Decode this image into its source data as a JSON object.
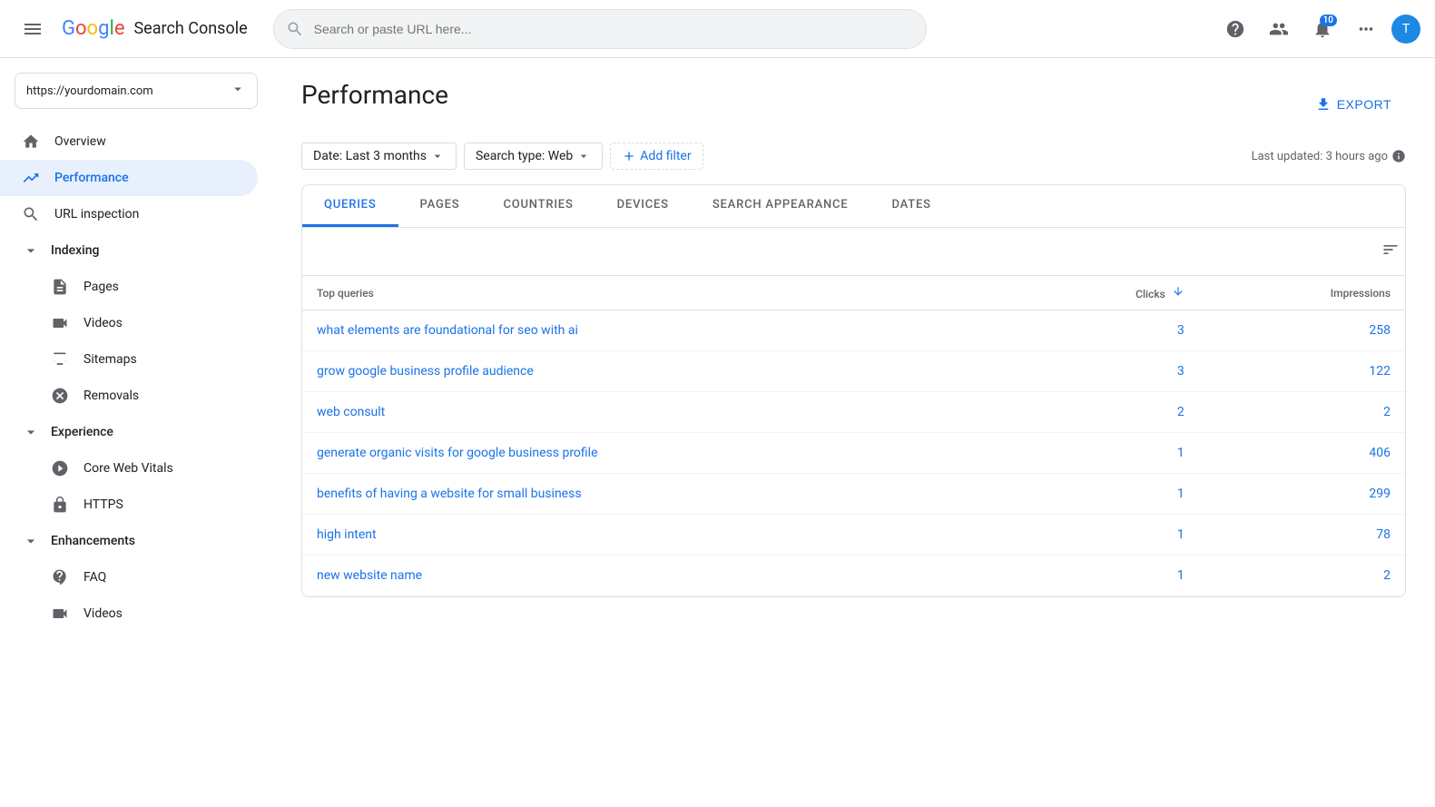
{
  "header": {
    "search_placeholder": "Search or paste URL here...",
    "app_name": "Search Console",
    "notification_count": "10",
    "avatar_letter": "T"
  },
  "sidebar": {
    "property_selector": "https://yourdomain.com",
    "nav_items": [
      {
        "id": "overview",
        "label": "Overview",
        "icon": "home"
      },
      {
        "id": "performance",
        "label": "Performance",
        "icon": "trending-up",
        "active": true
      },
      {
        "id": "url-inspection",
        "label": "URL inspection",
        "icon": "search"
      }
    ],
    "sections": [
      {
        "id": "indexing",
        "label": "Indexing",
        "children": [
          {
            "id": "pages",
            "label": "Pages",
            "icon": "document"
          },
          {
            "id": "videos",
            "label": "Videos",
            "icon": "video"
          },
          {
            "id": "sitemaps",
            "label": "Sitemaps",
            "icon": "sitemap"
          },
          {
            "id": "removals",
            "label": "Removals",
            "icon": "removals"
          }
        ]
      },
      {
        "id": "experience",
        "label": "Experience",
        "children": [
          {
            "id": "core-web-vitals",
            "label": "Core Web Vitals",
            "icon": "cwv"
          },
          {
            "id": "https",
            "label": "HTTPS",
            "icon": "lock"
          }
        ]
      },
      {
        "id": "enhancements",
        "label": "Enhancements",
        "children": [
          {
            "id": "faq",
            "label": "FAQ",
            "icon": "faq"
          },
          {
            "id": "videos-enh",
            "label": "Videos",
            "icon": "video"
          }
        ]
      }
    ]
  },
  "page": {
    "title": "Performance",
    "export_label": "EXPORT",
    "last_updated": "Last updated: 3 hours ago"
  },
  "filters": {
    "date_filter": "Date: Last 3 months",
    "search_type_filter": "Search type: Web",
    "add_filter_label": "Add filter"
  },
  "tabs": [
    {
      "id": "queries",
      "label": "QUERIES",
      "active": true
    },
    {
      "id": "pages",
      "label": "PAGES",
      "active": false
    },
    {
      "id": "countries",
      "label": "COUNTRIES",
      "active": false
    },
    {
      "id": "devices",
      "label": "DEVICES",
      "active": false
    },
    {
      "id": "search-appearance",
      "label": "SEARCH APPEARANCE",
      "active": false
    },
    {
      "id": "dates",
      "label": "DATES",
      "active": false
    }
  ],
  "table": {
    "col_query": "Top queries",
    "col_clicks": "Clicks",
    "col_impressions": "Impressions",
    "rows": [
      {
        "query": "what elements are foundational for seo with ai",
        "clicks": "3",
        "impressions": "258"
      },
      {
        "query": "grow google business profile audience",
        "clicks": "3",
        "impressions": "122"
      },
      {
        "query": "web consult",
        "clicks": "2",
        "impressions": "2"
      },
      {
        "query": "generate organic visits for google business profile",
        "clicks": "1",
        "impressions": "406"
      },
      {
        "query": "benefits of having a website for small business",
        "clicks": "1",
        "impressions": "299"
      },
      {
        "query": "high intent",
        "clicks": "1",
        "impressions": "78"
      },
      {
        "query": "new website name",
        "clicks": "1",
        "impressions": "2"
      }
    ]
  }
}
